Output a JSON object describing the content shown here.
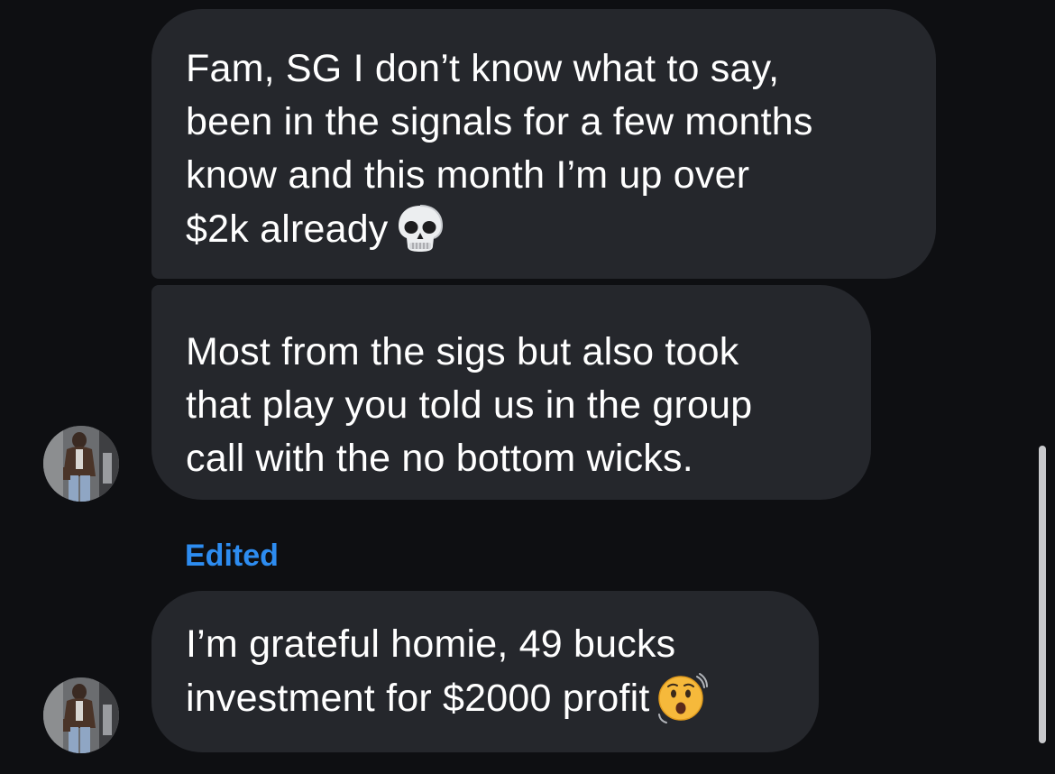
{
  "messages": [
    {
      "lines": [
        "Fam, SG I don’t know what to say,",
        "been in the signals for a few months",
        "know and this month I’m up over",
        "$2k already"
      ],
      "emoji": "skull-emoji"
    },
    {
      "lines": [
        "Most from the sigs but also took",
        "that play you told us in the group",
        "call with the no bottom wicks."
      ]
    },
    {
      "edited_label": "Edited",
      "lines": [
        "I’m grateful homie, 49 bucks",
        "investment for $2000 profit"
      ],
      "emoji": "astonished-face-emoji"
    }
  ],
  "colors": {
    "background": "#0e0f12",
    "bubble": "#25272c",
    "edited": "#2d8cf0",
    "text": "#ffffff"
  },
  "icons": [
    "avatar-photo",
    "skull-emoji",
    "astonished-face-emoji"
  ]
}
